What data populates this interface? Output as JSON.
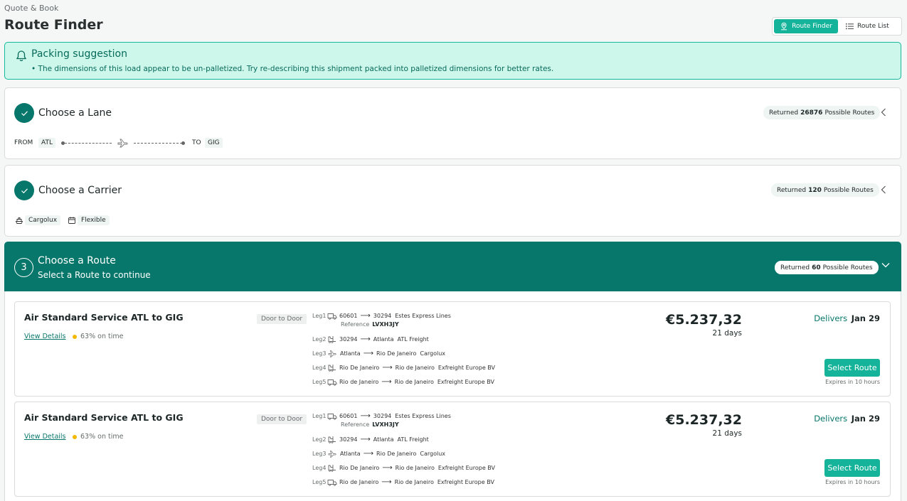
{
  "header": {
    "breadcrumb": "Quote & Book",
    "title": "Route Finder",
    "view_toggle": {
      "route_finder": "Route Finder",
      "route_list": "Route List"
    }
  },
  "alert": {
    "title": "Packing suggestion",
    "text": "• The dimensions of this load appear to be un-palletized. Try re-describing this shipment packed into palletized dimensions for better rates."
  },
  "lane": {
    "title": "Choose a Lane",
    "returned_prefix": "Returned",
    "returned_count": "26876",
    "returned_suffix": "Possible Routes",
    "from_label": "FROM",
    "from_code": "ATL",
    "to_label": "TO",
    "to_code": "GIG"
  },
  "carrier": {
    "title": "Choose a Carrier",
    "returned_prefix": "Returned",
    "returned_count": "120",
    "returned_suffix": "Possible Routes",
    "carrier_name": "Cargolux",
    "schedule": "Flexible"
  },
  "route": {
    "step_number": "3",
    "title": "Choose a Route",
    "subtitle": "Select a Route to continue",
    "returned_prefix": "Returned",
    "returned_count": "60",
    "returned_suffix": "Possible Routes"
  },
  "routes": [
    {
      "service": "Air Standard Service ATL to GIG",
      "view_details": "View Details",
      "on_time": "63% on time",
      "door": "Door to Door",
      "legs": [
        {
          "n": "Leg1",
          "from": "60601",
          "to": "30294",
          "carrier": "Estes Express Lines"
        },
        {
          "n": "Leg2",
          "from": "30294",
          "to": "Atlanta",
          "carrier": "ATL Freight"
        },
        {
          "n": "Leg3",
          "from": "Atlanta",
          "to": "Rio De Janeiro",
          "carrier": "Cargolux"
        },
        {
          "n": "Leg4",
          "from": "Rio De Janeiro",
          "to": "Rio de Janeiro",
          "carrier": "Exfreight Europe BV"
        },
        {
          "n": "Leg5",
          "from": "Rio de Janeiro",
          "to": "Rio de Janeiro",
          "carrier": "Exfreight Europe BV"
        }
      ],
      "reference_label": "Reference",
      "reference": "LVXH3JY",
      "price": "€5.237,32",
      "days": "21 days",
      "delivers_label": "Delivers",
      "delivers_date": "Jan 29",
      "select": "Select Route",
      "expires": "Expires in 10 hours"
    },
    {
      "service": "Air Standard Service ATL to GIG",
      "view_details": "View Details",
      "on_time": "63% on time",
      "door": "Door to Door",
      "legs": [
        {
          "n": "Leg1",
          "from": "60601",
          "to": "30294",
          "carrier": "Estes Express Lines"
        },
        {
          "n": "Leg2",
          "from": "30294",
          "to": "Atlanta",
          "carrier": "ATL Freight"
        },
        {
          "n": "Leg3",
          "from": "Atlanta",
          "to": "Rio De Janeiro",
          "carrier": "Cargolux"
        },
        {
          "n": "Leg4",
          "from": "Rio De Janeiro",
          "to": "Rio de Janeiro",
          "carrier": "Exfreight Europe BV"
        },
        {
          "n": "Leg5",
          "from": "Rio de Janeiro",
          "to": "Rio de Janeiro",
          "carrier": "Exfreight Europe BV"
        }
      ],
      "reference_label": "Reference",
      "reference": "LVXH3JY",
      "price": "€5.237,32",
      "days": "21 days",
      "delivers_label": "Delivers",
      "delivers_date": "Jan 29",
      "select": "Select Route",
      "expires": "Expires in 10 hours"
    }
  ],
  "colors": {
    "brand": "#08776b",
    "accent": "#15b39a",
    "alert_bg": "#cdf7ea",
    "ontime_dot": "#f5b800"
  }
}
